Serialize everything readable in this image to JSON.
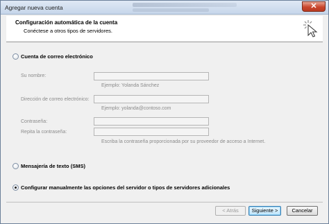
{
  "window": {
    "title": "Agregar nueva cuenta",
    "close_label": "✕"
  },
  "header": {
    "title": "Configuración automática de la cuenta",
    "subtitle": "Conéctese a otros tipos de servidores."
  },
  "options": {
    "email_account": {
      "label": "Cuenta de correo electrónico",
      "selected": false
    },
    "sms": {
      "label": "Mensajería de texto (SMS)",
      "selected": false
    },
    "manual": {
      "label": "Configurar manualmente las opciones del servidor o tipos de servidores adicionales",
      "selected": true
    }
  },
  "fields": {
    "name": {
      "label": "Su nombre:",
      "value": "",
      "hint": "Ejemplo: Yolanda Sánchez"
    },
    "email": {
      "label": "Dirección de correo electrónico:",
      "value": "",
      "hint": "Ejemplo: yolanda@contoso.com"
    },
    "password": {
      "label": "Contraseña:",
      "value": ""
    },
    "repeat_password": {
      "label": "Repita la contraseña:",
      "value": "",
      "hint": "Escriba la contraseña proporcionada por su proveedor de acceso a Internet."
    }
  },
  "buttons": {
    "back": "< Atrás",
    "next": "Siguiente >",
    "cancel": "Cancelar"
  },
  "icons": {
    "header_icon": "cursor-click-icon",
    "close_icon": "close-icon"
  },
  "colors": {
    "title_bar": "#c6d6ea",
    "dialog_bg": "#f0f0f0",
    "header_bg": "#ffffff",
    "close_button": "#c9462c",
    "default_button_border": "#3c7fb1"
  }
}
